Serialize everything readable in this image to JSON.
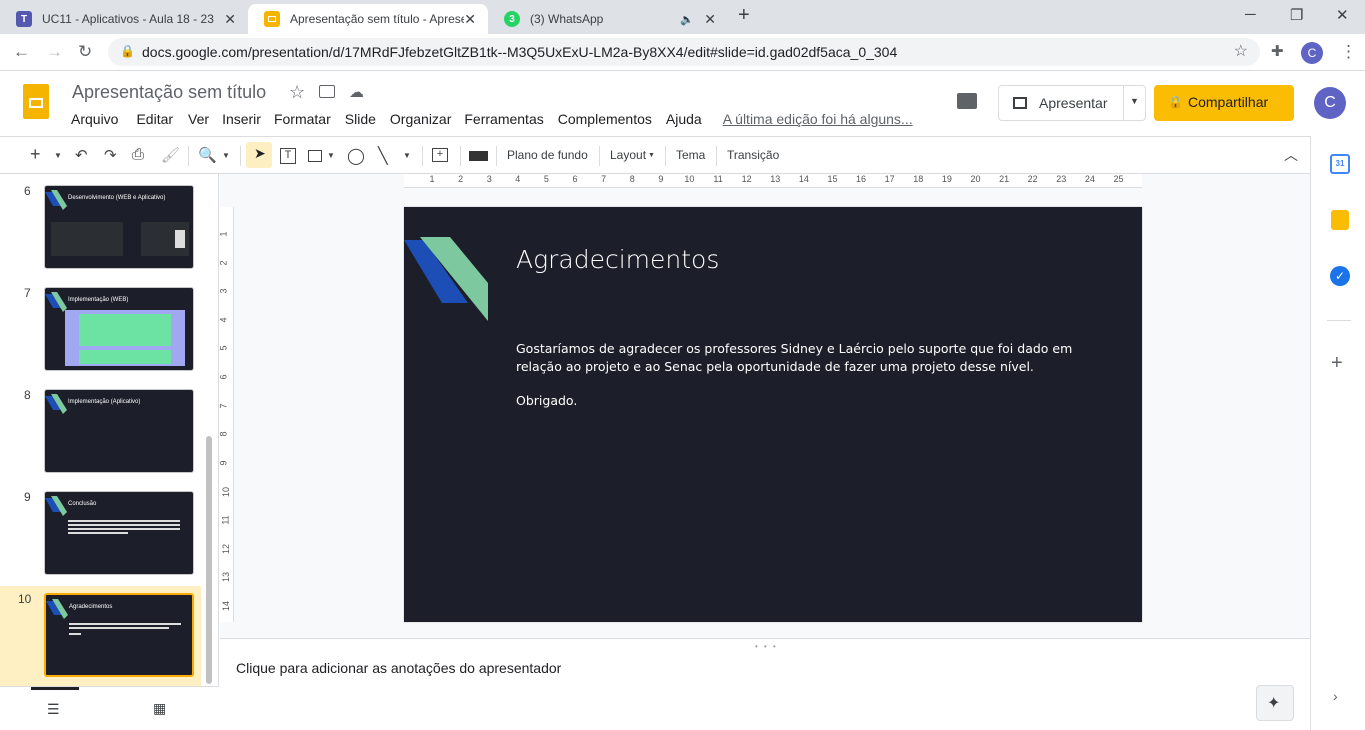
{
  "browser": {
    "tabs": [
      {
        "title": "UC11 - Aplicativos - Aula 18 - 23",
        "icon": "teams-icon"
      },
      {
        "title": "Apresentação sem título - Apresentações Google",
        "icon": "slides-icon"
      },
      {
        "title": "(3) WhatsApp",
        "icon": "whatsapp-icon",
        "badge": "3"
      }
    ],
    "url": "docs.google.com/presentation/d/17MRdFJfebzetGltZB1tk--M3Q5UxExU-LM2a-By8XX4/edit#slide=id.gad02df5aca_0_304",
    "profile_initial": "C"
  },
  "docs": {
    "title": "Apresentação sem título",
    "menu": [
      "Arquivo",
      "Editar",
      "Ver",
      "Inserir",
      "Formatar",
      "Slide",
      "Organizar",
      "Ferramentas",
      "Complementos",
      "Ajuda"
    ],
    "last_edit": "A última edição foi há alguns...",
    "present_label": "Apresentar",
    "share_label": "Compartilhar",
    "avatar_initial": "C"
  },
  "toolbar": {
    "background": "Plano de fundo",
    "layout": "Layout",
    "theme": "Tema",
    "transition": "Transição"
  },
  "ruler": {
    "h": [
      "1",
      "2",
      "3",
      "4",
      "5",
      "6",
      "7",
      "8",
      "9",
      "10",
      "11",
      "12",
      "13",
      "14",
      "15",
      "16",
      "17",
      "18",
      "19",
      "20",
      "21",
      "22",
      "23",
      "24",
      "25"
    ],
    "v": [
      "1",
      "2",
      "3",
      "4",
      "5",
      "6",
      "7",
      "8",
      "9",
      "10",
      "11",
      "12",
      "13",
      "14"
    ]
  },
  "slides": [
    {
      "num": "6",
      "title": "Desenvolvimento (WEB e Aplicativo)"
    },
    {
      "num": "7",
      "title": "Implementação (WEB)"
    },
    {
      "num": "8",
      "title": "Implementação (Aplicativo)"
    },
    {
      "num": "9",
      "title": "Conclusão"
    },
    {
      "num": "10",
      "title": "Agradecimentos",
      "selected": true
    }
  ],
  "current_slide": {
    "title": "Agradecimentos",
    "body": "Gostaríamos de agradecer os professores Sidney e Laércio pelo suporte que foi dado em relação ao projeto e ao Senac pela oportunidade de fazer uma projeto desse nível.",
    "closing": "Obrigado."
  },
  "notes_placeholder": "Clique para adicionar as anotações do apresentador",
  "colors": {
    "slide_bg": "#1c1f2a",
    "accent_blue": "#1c4eb5",
    "accent_green": "#7ec8a0",
    "share_yellow": "#fbbc04",
    "selected_bg": "#fef0c3"
  }
}
